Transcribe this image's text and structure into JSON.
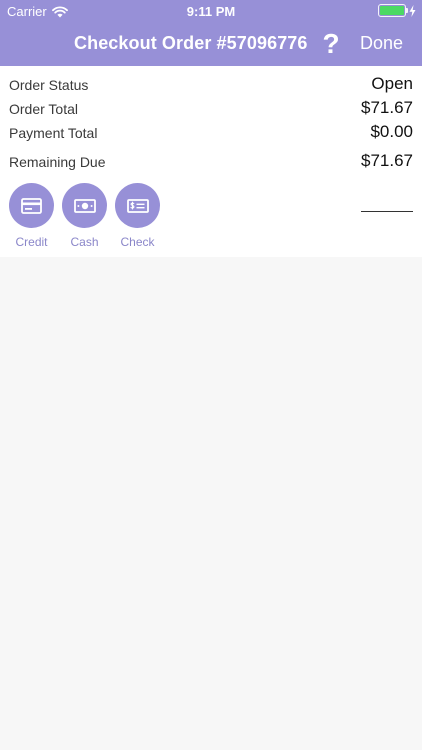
{
  "status_bar": {
    "carrier": "Carrier",
    "time": "9:11 PM",
    "battery_level": 1.0
  },
  "nav": {
    "title": "Checkout Order #57096776",
    "help_label": "?",
    "done_label": "Done"
  },
  "summary": {
    "order_status_label": "Order Status",
    "order_status_value": "Open",
    "order_total_label": "Order Total",
    "order_total_value": "$71.67",
    "payment_total_label": "Payment Total",
    "payment_total_value": "$0.00",
    "remaining_due_label": "Remaining Due",
    "remaining_due_value": "$71.67"
  },
  "payment_methods": [
    {
      "label": "Credit",
      "icon": "credit-card-icon"
    },
    {
      "label": "Cash",
      "icon": "cash-icon"
    },
    {
      "label": "Check",
      "icon": "check-icon"
    }
  ],
  "colors": {
    "accent": "#9790d7",
    "method_label": "#8a86c9",
    "background": "#f7f7f7",
    "panel": "#ffffff",
    "battery": "#4cd964"
  }
}
